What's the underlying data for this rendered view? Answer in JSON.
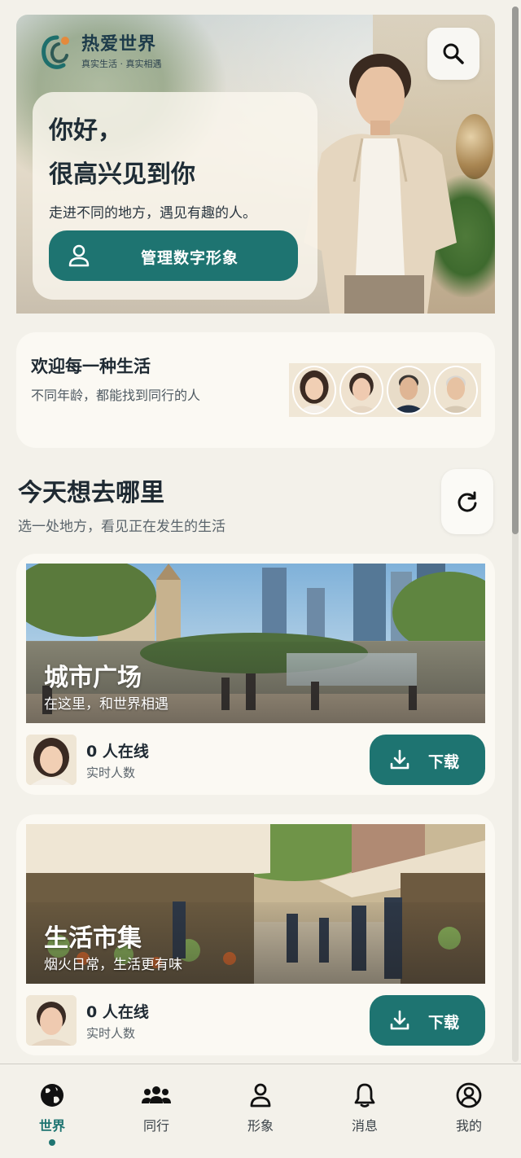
{
  "app": {
    "name": "热爱世界",
    "slogan": "真实生活 · 真实相遇"
  },
  "hero": {
    "greeting_line1": "你好，",
    "greeting_line2": "很高兴见到你",
    "intro": "走进不同的地方，遇见有趣的人。",
    "manage_button": "管理数字形象"
  },
  "welcome": {
    "title": "欢迎每一种生活",
    "subtitle": "不同年龄，都能找到同行的人"
  },
  "section": {
    "title": "今天想去哪里",
    "subtitle": "选一处地方，看见正在发生的生活"
  },
  "places": [
    {
      "name": "城市广场",
      "tagline": "在这里，和世界相遇",
      "online": "0 人在线",
      "online_label": "实时人数",
      "download": "下载"
    },
    {
      "name": "生活市集",
      "tagline": "烟火日常，生活更有味",
      "online": "0 人在线",
      "online_label": "实时人数",
      "download": "下载"
    }
  ],
  "nav": [
    {
      "label": "世界",
      "icon": "globe-icon",
      "active": true
    },
    {
      "label": "同行",
      "icon": "group-icon",
      "active": false
    },
    {
      "label": "形象",
      "icon": "person-icon",
      "active": false
    },
    {
      "label": "消息",
      "icon": "bell-icon",
      "active": false
    },
    {
      "label": "我的",
      "icon": "profile-circle-icon",
      "active": false
    }
  ],
  "colors": {
    "accent": "#1e7471",
    "background": "#f3f1ea",
    "card": "#fbf9f3",
    "text_dark": "#1f2a33"
  }
}
